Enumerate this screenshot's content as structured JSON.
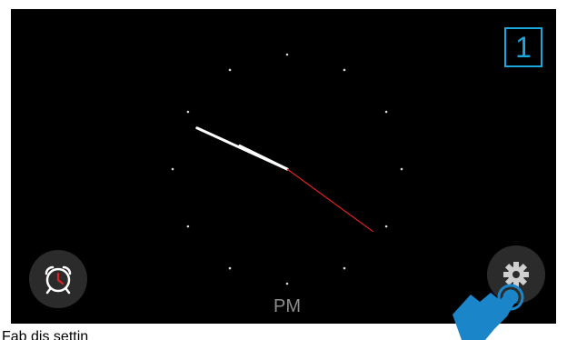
{
  "screen": {
    "badge_number": "1",
    "period_label": "PM",
    "time": {
      "hour": 9,
      "minute": 49,
      "second": 21
    }
  },
  "buttons": {
    "alarm_icon": "alarm-clock-icon",
    "settings_icon": "gear-icon"
  },
  "pointer_icon": "tapping-hand-icon",
  "caption": "Fab dis settin",
  "colors": {
    "background": "#000000",
    "accent": "#19a7dc",
    "second_hand": "#e02020",
    "alarm_red": "#e02020",
    "pointer_blue": "#1a86c9"
  }
}
